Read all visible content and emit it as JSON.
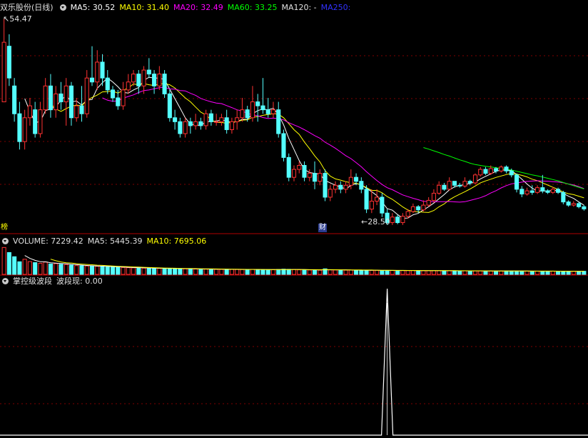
{
  "price_panel": {
    "stock_name": "双乐股份(日线)",
    "ma5_label": "MA5: 30.52",
    "ma10_label": "MA10: 31.40",
    "ma20_label": "MA20: 32.49",
    "ma60_label": "MA60: 33.25",
    "ma120_label": "MA120: -",
    "ma250_label": "MA250:",
    "high_label": "54.47",
    "low_label": "28.50",
    "tag_left": "榜",
    "tag_fin": "财"
  },
  "volume_panel": {
    "volume_label": "VOLUME: 7229.42",
    "ma5_label": "MA5: 5445.39",
    "ma10_label": "MA10: 7695.06"
  },
  "indicator_panel": {
    "name": "掌控级波段",
    "value_label": "波段现: 0.00"
  },
  "colors": {
    "up": "#ff3232",
    "down": "#54ffff",
    "ma5": "#ffffff",
    "ma10": "#ffff00",
    "ma20": "#ff00ff",
    "ma60": "#00ff00",
    "ma120": "#e0e0e0",
    "ma250": "#3232ff",
    "grid": "#800000"
  },
  "chart_data": [
    {
      "type": "candlestick",
      "title": "双乐股份(日线)",
      "high_marker": 54.47,
      "low_marker": 28.5,
      "ylim": [
        27.5,
        55.2
      ],
      "candles": [
        [
          44,
          51.5,
          45,
          54.47
        ],
        [
          51,
          47,
          46,
          52.5
        ],
        [
          46,
          42.5,
          41.5,
          47
        ],
        [
          42.5,
          39,
          38,
          44
        ],
        [
          39,
          42,
          38,
          43
        ],
        [
          42,
          43.5,
          41,
          44.5
        ],
        [
          43,
          40,
          39.5,
          44
        ],
        [
          40,
          43,
          39.5,
          44
        ],
        [
          43,
          46,
          42.5,
          47
        ],
        [
          46,
          43,
          42,
          47.5
        ],
        [
          43,
          45,
          42,
          46
        ],
        [
          45,
          44,
          43,
          46.5
        ],
        [
          44,
          46,
          41,
          47
        ],
        [
          46,
          42,
          41,
          46.5
        ],
        [
          42,
          43.5,
          41.5,
          44.5
        ],
        [
          43.5,
          42.5,
          41.5,
          46
        ],
        [
          42.5,
          47,
          42,
          48
        ],
        [
          47,
          46.5,
          46,
          51
        ],
        [
          46.5,
          49,
          45.5,
          50.5
        ],
        [
          49,
          47,
          46,
          50
        ],
        [
          47,
          45.5,
          45,
          48
        ],
        [
          45.5,
          44.5,
          44,
          46
        ],
        [
          44.5,
          43.5,
          43,
          45.5
        ],
        [
          43.5,
          45.5,
          43,
          46.5
        ],
        [
          45.5,
          46.5,
          45,
          47.5
        ],
        [
          46.5,
          47.5,
          46,
          48
        ],
        [
          47.5,
          46,
          45,
          48
        ],
        [
          46,
          48,
          45,
          48.5
        ],
        [
          48,
          47.5,
          47,
          49.5
        ],
        [
          47.5,
          46,
          45,
          48
        ],
        [
          46,
          47.5,
          45.5,
          48.5
        ],
        [
          47.5,
          45,
          44.5,
          48
        ],
        [
          45,
          42,
          41.5,
          45.5
        ],
        [
          42,
          41.5,
          40.5,
          43
        ],
        [
          41.5,
          40,
          39.5,
          42
        ],
        [
          40,
          41.5,
          39.5,
          42
        ],
        [
          41.5,
          41,
          40,
          42
        ],
        [
          41,
          41.5,
          40.5,
          42.5
        ],
        [
          41.5,
          41,
          40.5,
          42
        ],
        [
          41,
          42.5,
          40.5,
          43
        ],
        [
          42.5,
          41.5,
          41,
          43
        ],
        [
          41.5,
          41.5,
          41,
          42.5
        ],
        [
          41.5,
          42,
          41,
          42.5
        ],
        [
          42,
          40.5,
          40,
          43
        ],
        [
          40.5,
          41.5,
          40,
          42
        ],
        [
          41.5,
          42,
          40.5,
          43
        ],
        [
          42,
          43,
          41.5,
          44.5
        ],
        [
          43,
          42,
          41.5,
          43.5
        ],
        [
          42,
          44,
          41.5,
          46
        ],
        [
          44,
          43.5,
          41.5,
          45
        ],
        [
          43.5,
          43,
          42.5,
          47
        ],
        [
          43,
          42.5,
          42,
          44.5
        ],
        [
          42.5,
          43,
          42,
          44
        ],
        [
          43,
          40,
          39.5,
          44
        ],
        [
          40,
          37,
          36.5,
          40.5
        ],
        [
          37,
          34.5,
          34,
          37.5
        ],
        [
          34.5,
          35.5,
          34,
          36
        ],
        [
          35.5,
          36,
          35,
          36.5
        ],
        [
          36,
          34.5,
          34,
          36.5
        ],
        [
          34.5,
          35,
          34,
          35.5
        ],
        [
          35,
          34,
          33,
          36.5
        ],
        [
          34,
          35,
          33.5,
          35.5
        ],
        [
          35,
          32,
          31.5,
          35.5
        ],
        [
          32,
          33,
          31.5,
          33.5
        ],
        [
          33,
          33.5,
          32.5,
          34
        ],
        [
          33.5,
          33,
          32.5,
          34
        ],
        [
          33,
          33.5,
          32.5,
          34
        ],
        [
          33.5,
          34.5,
          33,
          35.5
        ],
        [
          34.5,
          34,
          33.5,
          35
        ],
        [
          34,
          33,
          32.5,
          34.5
        ],
        [
          33,
          30.5,
          30,
          33.5
        ],
        [
          30.5,
          31.5,
          30,
          33
        ],
        [
          31.5,
          32,
          31,
          33
        ],
        [
          32,
          30,
          29.5,
          32.5
        ],
        [
          30,
          28.8,
          28.5,
          30.5
        ],
        [
          28.8,
          29.5,
          28.5,
          30
        ],
        [
          29.5,
          28.8,
          28.6,
          29.8
        ],
        [
          28.8,
          29.6,
          28.5,
          30
        ],
        [
          29.6,
          30.2,
          29.3,
          30.5
        ],
        [
          30.2,
          30.8,
          30,
          31.2
        ],
        [
          30.8,
          30.4,
          30,
          31
        ],
        [
          30.4,
          31,
          30.2,
          31.6
        ],
        [
          31,
          31.6,
          30.8,
          32
        ],
        [
          31.6,
          32.5,
          31.3,
          33
        ],
        [
          32.5,
          33.5,
          32.3,
          34
        ],
        [
          33.5,
          33,
          32.8,
          33.8
        ],
        [
          33,
          34,
          32.8,
          34.5
        ],
        [
          34,
          33.5,
          33.2,
          34
        ],
        [
          33.5,
          33.4,
          33.2,
          33.8
        ],
        [
          33.4,
          34,
          33.2,
          34.5
        ],
        [
          34,
          33.8,
          33.5,
          34.2
        ],
        [
          33.8,
          34.8,
          33.6,
          35
        ],
        [
          34.8,
          35.5,
          34.6,
          35.8
        ],
        [
          35.5,
          35,
          34.8,
          35.8
        ],
        [
          35,
          35.6,
          34.8,
          36
        ],
        [
          35.6,
          35.3,
          35,
          35.8
        ],
        [
          35.3,
          35.8,
          35.1,
          36
        ],
        [
          35.8,
          35.3,
          35,
          36
        ],
        [
          35.3,
          34.8,
          34.5,
          35.6
        ],
        [
          34.8,
          33,
          32.6,
          35
        ],
        [
          33,
          32.4,
          32,
          33.4
        ],
        [
          32.4,
          32.8,
          32.2,
          33.2
        ],
        [
          32.8,
          32.6,
          32.3,
          33.5
        ],
        [
          32.6,
          33.2,
          32.4,
          33.5
        ],
        [
          33.2,
          32.8,
          32.5,
          34.8
        ],
        [
          32.8,
          32.6,
          32.4,
          33
        ],
        [
          32.6,
          33,
          32.4,
          33.3
        ],
        [
          33,
          32.6,
          32.4,
          33.2
        ],
        [
          32.6,
          31.4,
          31.1,
          32.8
        ],
        [
          31.4,
          31,
          30.8,
          31.6
        ],
        [
          31,
          31.2,
          30.8,
          31.5
        ],
        [
          31.2,
          30.8,
          30.6,
          31.4
        ],
        [
          30.8,
          30.52,
          30.3,
          31
        ]
      ],
      "ma60_visible_from": 81
    },
    {
      "type": "bar",
      "title": "VOLUME",
      "values": [
        16000,
        13000,
        10500,
        7500,
        9000,
        7600,
        7000,
        6600,
        7300,
        6200,
        6400,
        6000,
        5800,
        5500,
        5200,
        5100,
        5000,
        4900,
        4800,
        4700,
        4500,
        4300,
        4200,
        4100,
        4000,
        3900,
        3800,
        3700,
        3650,
        3600,
        3550,
        3500,
        3450,
        3400,
        3350,
        3300,
        3250,
        3200,
        3150,
        3100,
        3050,
        3000,
        3000,
        3000,
        2950,
        2900,
        2900,
        2850,
        3000,
        2900,
        2800,
        2800,
        2750,
        2900,
        3100,
        3000,
        2900,
        2700,
        2700,
        2600,
        2600,
        2500,
        3300,
        2700,
        2600,
        2500,
        2500,
        2600,
        2500,
        2400,
        2400,
        2400,
        2400,
        2350,
        2300,
        2300,
        2300,
        2300,
        2250,
        2250,
        2250,
        2200,
        2200,
        2200,
        2150,
        2150,
        2150,
        2100,
        2100,
        2100,
        2050,
        2050,
        2050,
        2000,
        2000,
        2000,
        2000,
        2000,
        2000,
        1950,
        1950,
        1950,
        1900,
        1900,
        1900,
        1900,
        1900,
        1900,
        1850,
        1850,
        1850,
        1850,
        1850
      ],
      "ylim": [
        0,
        17000
      ]
    },
    {
      "type": "line",
      "title": "掌控级波段",
      "spike_index": 74,
      "spike_value": 1,
      "value_current": 0.0
    }
  ]
}
